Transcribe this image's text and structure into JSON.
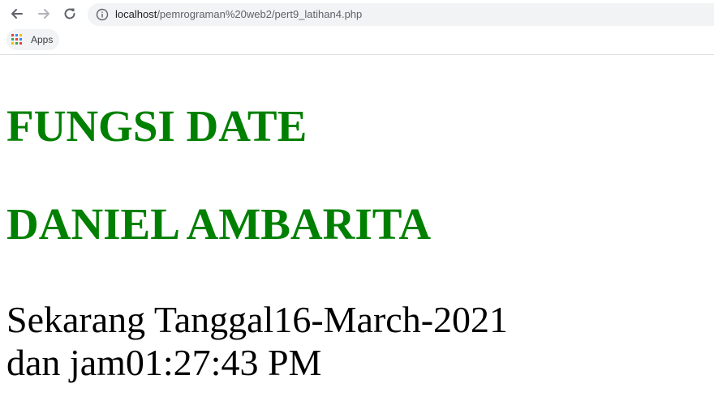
{
  "browser": {
    "url_host": "localhost",
    "url_path": "/pemrograman%20web2/pert9_latihan4.php",
    "bookmarks": [
      {
        "label": "Apps",
        "icon": "apps-grid-icon"
      }
    ],
    "nav_icons": [
      "back-arrow-icon",
      "forward-arrow-icon",
      "reload-icon",
      "info-icon"
    ]
  },
  "page": {
    "heading_color": "#008000",
    "title": "FUNGSI DATE",
    "author": "DANIEL AMBARITA",
    "date_prefix": "Sekarang Tanggal",
    "date_value": "16-March-2021",
    "time_prefix": "dan jam",
    "time_value": "01:27:43 PM"
  }
}
